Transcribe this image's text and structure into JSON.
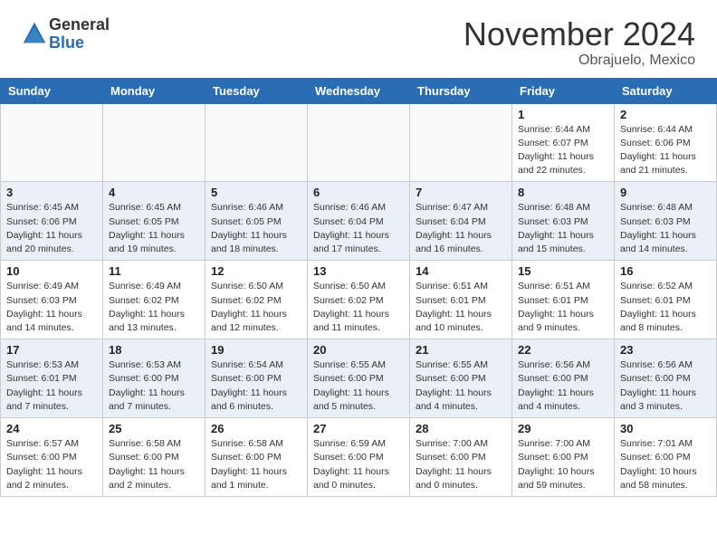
{
  "header": {
    "logo_general": "General",
    "logo_blue": "Blue",
    "month_title": "November 2024",
    "location": "Obrajuelo, Mexico"
  },
  "weekdays": [
    "Sunday",
    "Monday",
    "Tuesday",
    "Wednesday",
    "Thursday",
    "Friday",
    "Saturday"
  ],
  "weeks": [
    [
      {
        "day": "",
        "info": ""
      },
      {
        "day": "",
        "info": ""
      },
      {
        "day": "",
        "info": ""
      },
      {
        "day": "",
        "info": ""
      },
      {
        "day": "",
        "info": ""
      },
      {
        "day": "1",
        "info": "Sunrise: 6:44 AM\nSunset: 6:07 PM\nDaylight: 11 hours and 22 minutes."
      },
      {
        "day": "2",
        "info": "Sunrise: 6:44 AM\nSunset: 6:06 PM\nDaylight: 11 hours and 21 minutes."
      }
    ],
    [
      {
        "day": "3",
        "info": "Sunrise: 6:45 AM\nSunset: 6:06 PM\nDaylight: 11 hours and 20 minutes."
      },
      {
        "day": "4",
        "info": "Sunrise: 6:45 AM\nSunset: 6:05 PM\nDaylight: 11 hours and 19 minutes."
      },
      {
        "day": "5",
        "info": "Sunrise: 6:46 AM\nSunset: 6:05 PM\nDaylight: 11 hours and 18 minutes."
      },
      {
        "day": "6",
        "info": "Sunrise: 6:46 AM\nSunset: 6:04 PM\nDaylight: 11 hours and 17 minutes."
      },
      {
        "day": "7",
        "info": "Sunrise: 6:47 AM\nSunset: 6:04 PM\nDaylight: 11 hours and 16 minutes."
      },
      {
        "day": "8",
        "info": "Sunrise: 6:48 AM\nSunset: 6:03 PM\nDaylight: 11 hours and 15 minutes."
      },
      {
        "day": "9",
        "info": "Sunrise: 6:48 AM\nSunset: 6:03 PM\nDaylight: 11 hours and 14 minutes."
      }
    ],
    [
      {
        "day": "10",
        "info": "Sunrise: 6:49 AM\nSunset: 6:03 PM\nDaylight: 11 hours and 14 minutes."
      },
      {
        "day": "11",
        "info": "Sunrise: 6:49 AM\nSunset: 6:02 PM\nDaylight: 11 hours and 13 minutes."
      },
      {
        "day": "12",
        "info": "Sunrise: 6:50 AM\nSunset: 6:02 PM\nDaylight: 11 hours and 12 minutes."
      },
      {
        "day": "13",
        "info": "Sunrise: 6:50 AM\nSunset: 6:02 PM\nDaylight: 11 hours and 11 minutes."
      },
      {
        "day": "14",
        "info": "Sunrise: 6:51 AM\nSunset: 6:01 PM\nDaylight: 11 hours and 10 minutes."
      },
      {
        "day": "15",
        "info": "Sunrise: 6:51 AM\nSunset: 6:01 PM\nDaylight: 11 hours and 9 minutes."
      },
      {
        "day": "16",
        "info": "Sunrise: 6:52 AM\nSunset: 6:01 PM\nDaylight: 11 hours and 8 minutes."
      }
    ],
    [
      {
        "day": "17",
        "info": "Sunrise: 6:53 AM\nSunset: 6:01 PM\nDaylight: 11 hours and 7 minutes."
      },
      {
        "day": "18",
        "info": "Sunrise: 6:53 AM\nSunset: 6:00 PM\nDaylight: 11 hours and 7 minutes."
      },
      {
        "day": "19",
        "info": "Sunrise: 6:54 AM\nSunset: 6:00 PM\nDaylight: 11 hours and 6 minutes."
      },
      {
        "day": "20",
        "info": "Sunrise: 6:55 AM\nSunset: 6:00 PM\nDaylight: 11 hours and 5 minutes."
      },
      {
        "day": "21",
        "info": "Sunrise: 6:55 AM\nSunset: 6:00 PM\nDaylight: 11 hours and 4 minutes."
      },
      {
        "day": "22",
        "info": "Sunrise: 6:56 AM\nSunset: 6:00 PM\nDaylight: 11 hours and 4 minutes."
      },
      {
        "day": "23",
        "info": "Sunrise: 6:56 AM\nSunset: 6:00 PM\nDaylight: 11 hours and 3 minutes."
      }
    ],
    [
      {
        "day": "24",
        "info": "Sunrise: 6:57 AM\nSunset: 6:00 PM\nDaylight: 11 hours and 2 minutes."
      },
      {
        "day": "25",
        "info": "Sunrise: 6:58 AM\nSunset: 6:00 PM\nDaylight: 11 hours and 2 minutes."
      },
      {
        "day": "26",
        "info": "Sunrise: 6:58 AM\nSunset: 6:00 PM\nDaylight: 11 hours and 1 minute."
      },
      {
        "day": "27",
        "info": "Sunrise: 6:59 AM\nSunset: 6:00 PM\nDaylight: 11 hours and 0 minutes."
      },
      {
        "day": "28",
        "info": "Sunrise: 7:00 AM\nSunset: 6:00 PM\nDaylight: 11 hours and 0 minutes."
      },
      {
        "day": "29",
        "info": "Sunrise: 7:00 AM\nSunset: 6:00 PM\nDaylight: 10 hours and 59 minutes."
      },
      {
        "day": "30",
        "info": "Sunrise: 7:01 AM\nSunset: 6:00 PM\nDaylight: 10 hours and 58 minutes."
      }
    ]
  ]
}
